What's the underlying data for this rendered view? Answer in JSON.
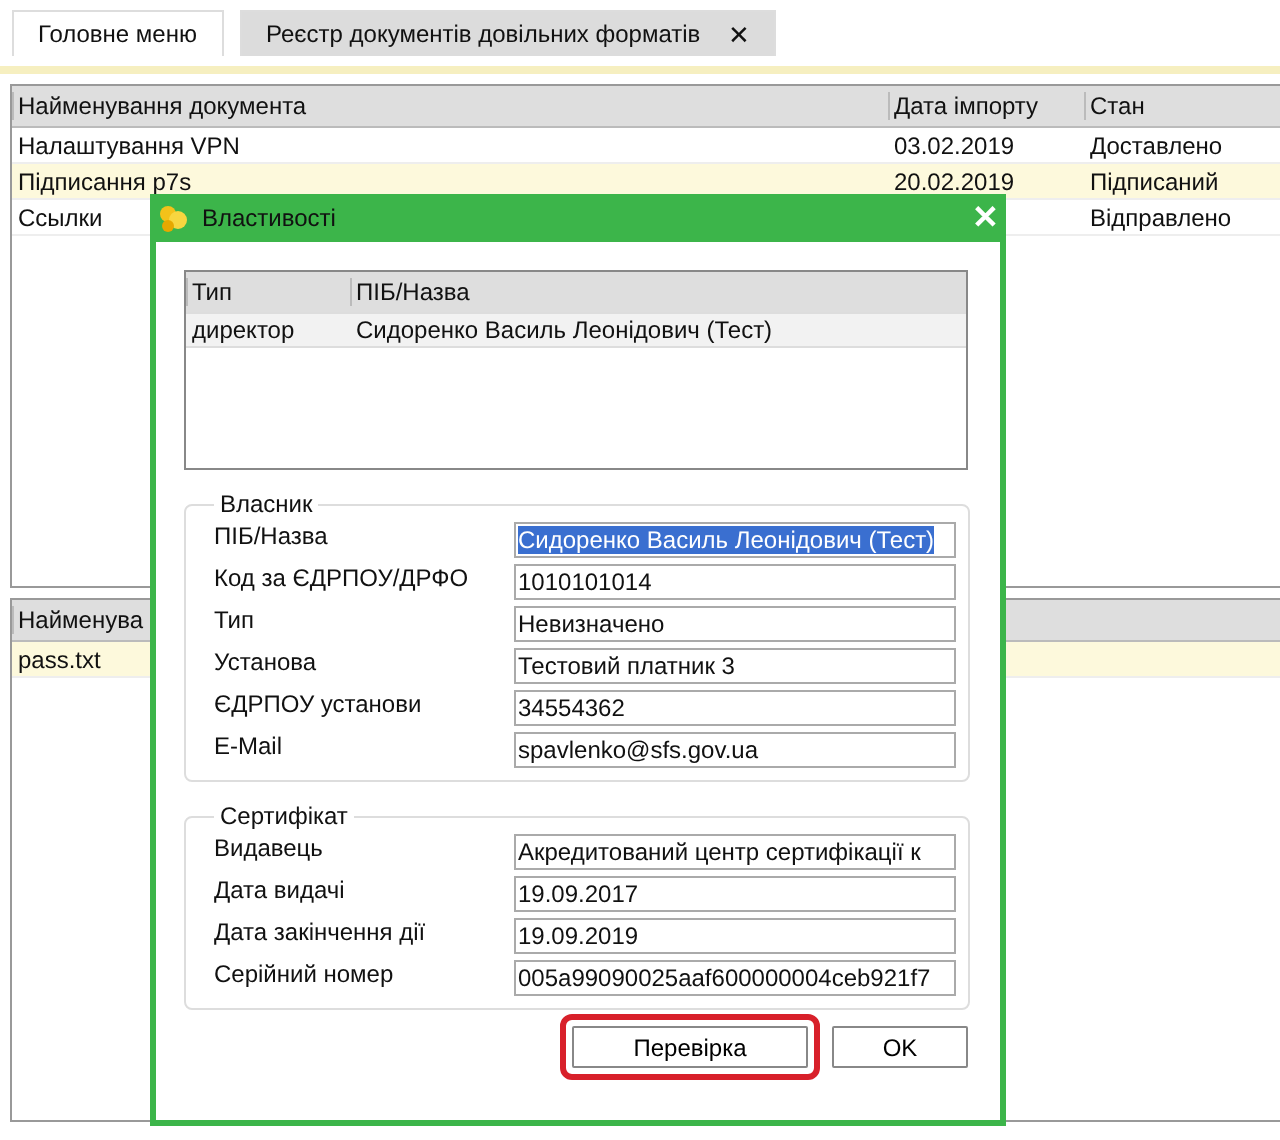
{
  "tabs": [
    {
      "label": "Головне меню",
      "selected": false,
      "closable": false
    },
    {
      "label": "Реєстр документів довільних форматів",
      "selected": true,
      "closable": true,
      "close": "✕"
    }
  ],
  "documents": {
    "columns": [
      "Найменування документа",
      "Дата імпорту",
      "Стан"
    ],
    "rows": [
      {
        "cells": [
          "Налаштування VPN",
          "03.02.2019",
          "Доставлено"
        ],
        "selected": false
      },
      {
        "cells": [
          "Підписання p7s",
          "20.02.2019",
          "Підписаний"
        ],
        "selected": true
      },
      {
        "cells": [
          "Ссылки",
          "",
          "Відправлено"
        ],
        "selected": false
      }
    ]
  },
  "files": {
    "columns": [
      "Найменува"
    ],
    "rows": [
      {
        "cells": [
          "pass.txt"
        ],
        "selected": true
      }
    ]
  },
  "dialog": {
    "title": "Властивості",
    "close": "✕",
    "signers": {
      "columns": [
        "Тип",
        "ПІБ/Назва"
      ],
      "rows": [
        {
          "cells": [
            "директор",
            "Сидоренко Василь Леонідович (Тест)"
          ],
          "selected": false
        }
      ]
    },
    "sections": [
      {
        "title": "Власник",
        "fields": [
          {
            "label": "ПІБ/Назва",
            "value": "Сидоренко Василь Леонідович (Тест)",
            "selected": true
          },
          {
            "label": "Код за ЄДРПОУ/ДРФО",
            "value": "1010101014",
            "selected": false
          },
          {
            "label": "Тип",
            "value": "Невизначено",
            "selected": false
          },
          {
            "label": "Установа",
            "value": "Тестовий платник 3",
            "selected": false
          },
          {
            "label": "ЄДРПОУ установи",
            "value": "34554362",
            "selected": false
          },
          {
            "label": "E-Mail",
            "value": "spavlenko@sfs.gov.ua",
            "selected": false
          }
        ]
      },
      {
        "title": "Сертифікат",
        "fields": [
          {
            "label": "Видавець",
            "value": "Акредитований центр сертифікації к",
            "selected": false
          },
          {
            "label": "Дата видачі",
            "value": "19.09.2017",
            "selected": false
          },
          {
            "label": "Дата закінчення дії",
            "value": "19.09.2019",
            "selected": false
          },
          {
            "label": "Серійний номер",
            "value": "005a99090025aaf600000004ceb921f7",
            "selected": false
          }
        ]
      }
    ],
    "buttons": [
      {
        "label": "Перевірка",
        "highlighted": true
      },
      {
        "label": "OK",
        "highlighted": false
      }
    ]
  }
}
